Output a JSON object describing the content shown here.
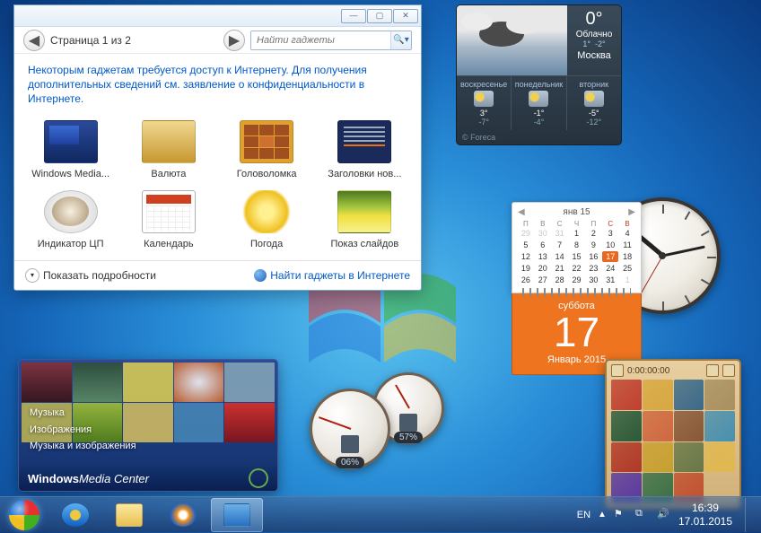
{
  "gallery": {
    "page_label": "Страница 1 из 2",
    "search_placeholder": "Найти гаджеты",
    "notice_a": "Некоторым гаджетам требуется доступ к Интернету. Для получения дополнительных сведений см. ",
    "notice_link": "заявление о конфиденциальности в Интернете",
    "notice_b": ".",
    "items": [
      {
        "label": "Windows Media..."
      },
      {
        "label": "Валюта"
      },
      {
        "label": "Головоломка"
      },
      {
        "label": "Заголовки нов..."
      },
      {
        "label": "Индикатор ЦП"
      },
      {
        "label": "Календарь"
      },
      {
        "label": "Погода"
      },
      {
        "label": "Показ слайдов"
      }
    ],
    "details": "Показать подробности",
    "find_more": "Найти гаджеты в Интернете"
  },
  "weather": {
    "temp": "0°",
    "cond": "Облачно",
    "hi": "1°",
    "lo": "-2°",
    "city": "Москва",
    "days": [
      {
        "name": "воскресенье",
        "hi": "3°",
        "lo": "-7°"
      },
      {
        "name": "понедельник",
        "hi": "-1°",
        "lo": "-4°"
      },
      {
        "name": "вторник",
        "hi": "-5°",
        "lo": "-12°"
      }
    ],
    "provider": "© Foreca"
  },
  "calendar": {
    "header": "янв 15",
    "dow": [
      "П",
      "В",
      "С",
      "Ч",
      "П",
      "С",
      "В"
    ],
    "grid": [
      {
        "n": "29",
        "o": 1
      },
      {
        "n": "30",
        "o": 1
      },
      {
        "n": "31",
        "o": 1
      },
      {
        "n": "1"
      },
      {
        "n": "2"
      },
      {
        "n": "3"
      },
      {
        "n": "4"
      },
      {
        "n": "5"
      },
      {
        "n": "6"
      },
      {
        "n": "7"
      },
      {
        "n": "8"
      },
      {
        "n": "9"
      },
      {
        "n": "10"
      },
      {
        "n": "11"
      },
      {
        "n": "12"
      },
      {
        "n": "13"
      },
      {
        "n": "14"
      },
      {
        "n": "15"
      },
      {
        "n": "16"
      },
      {
        "n": "17",
        "t": 1
      },
      {
        "n": "18"
      },
      {
        "n": "19"
      },
      {
        "n": "20"
      },
      {
        "n": "21"
      },
      {
        "n": "22"
      },
      {
        "n": "23"
      },
      {
        "n": "24"
      },
      {
        "n": "25"
      },
      {
        "n": "26"
      },
      {
        "n": "27"
      },
      {
        "n": "28"
      },
      {
        "n": "29"
      },
      {
        "n": "30"
      },
      {
        "n": "31"
      },
      {
        "n": "1",
        "o": 1
      }
    ],
    "weekday": "суббота",
    "daynum": "17",
    "month_year": "Январь 2015"
  },
  "cpu": {
    "g1": "06%",
    "g2": "57%"
  },
  "mediacenter": {
    "items": [
      "Музыка",
      "Изображения",
      "Музыка и изображения"
    ],
    "brand_a": "Windows",
    "brand_b": " Media Center"
  },
  "puzzle": {
    "timer": "0:00:00:00"
  },
  "taskbar": {
    "lang": "EN",
    "time": "16:39",
    "date": "17.01.2015"
  }
}
